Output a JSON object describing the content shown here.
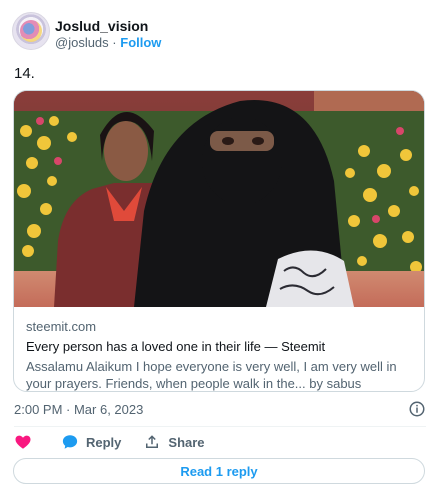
{
  "author": {
    "display_name": "Joslud_vision",
    "handle": "@josluds",
    "separator": "·",
    "follow_label": "Follow"
  },
  "tweet": {
    "text": "14."
  },
  "card": {
    "domain": "steemit.com",
    "title": "Every person has a loved one in their life — Steemit",
    "description": "Assalamu Alaikum I hope everyone is very well, I am very well in your prayers. Friends, when people walk in the... by sabus"
  },
  "meta": {
    "timestamp": "2:00 PM · Mar 6, 2023"
  },
  "actions": {
    "like_icon": "heart-icon",
    "reply_label": "Reply",
    "share_label": "Share"
  },
  "replies": {
    "label": "Read 1 reply"
  },
  "colors": {
    "accent": "#1d9bf0",
    "like": "#f91880",
    "muted": "#536471",
    "border": "#cfd9de"
  }
}
